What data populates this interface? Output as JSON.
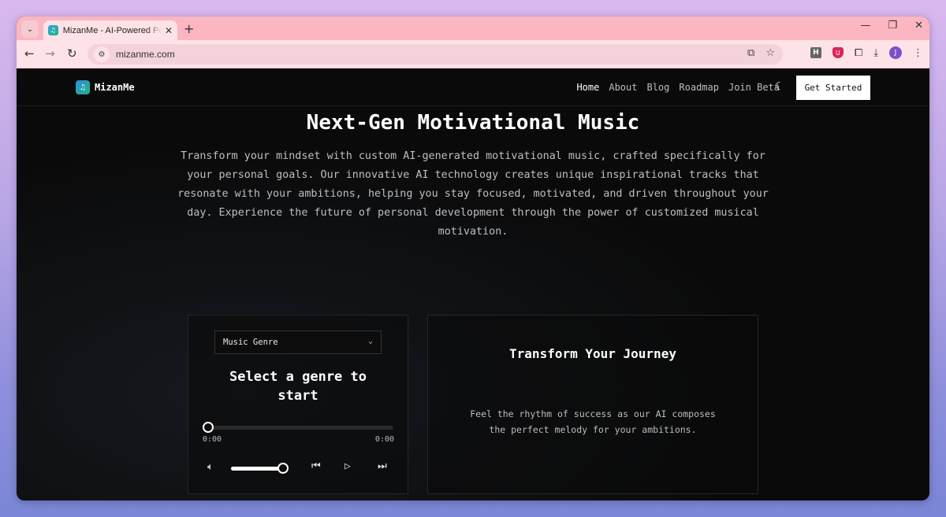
{
  "browser": {
    "tab": {
      "title": "MizanMe - AI-Powered Personal Motivation",
      "favicon": "headphones-icon"
    },
    "url": "mizanme.com",
    "profile_initial": "J",
    "ext_h_label": "H"
  },
  "site": {
    "logo_text": "MizanMe",
    "nav": [
      {
        "label": "Home",
        "active": true
      },
      {
        "label": "About",
        "active": false
      },
      {
        "label": "Blog",
        "active": false
      },
      {
        "label": "Roadmap",
        "active": false
      },
      {
        "label": "Join Beta",
        "active": false
      }
    ],
    "cta_label": "Get Started"
  },
  "hero": {
    "title": "Next-Gen Motivational Music",
    "description": "Transform your mindset with custom AI-generated motivational music, crafted specifically for your personal goals. Our innovative AI technology creates unique inspirational tracks that resonate with your ambitions, helping you stay focused, motivated, and driven throughout your day. Experience the future of personal development through the power of customized musical motivation."
  },
  "player": {
    "genre_select_value": "Music Genre",
    "title": "Select a genre to start",
    "current_time": "0:00",
    "duration": "0:00",
    "progress_fraction": 0,
    "volume_fraction": 1
  },
  "info_card": {
    "title": "Transform Your Journey",
    "description": "Feel the rhythm of success as our AI composes the perfect melody for your ambitions."
  }
}
